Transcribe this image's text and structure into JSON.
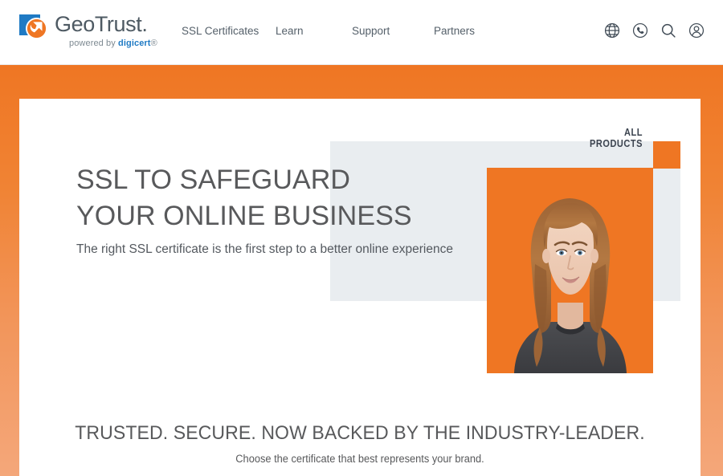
{
  "header": {
    "logo": {
      "name": "GeoTrust",
      "wordmark": "GeoTrust",
      "trademark": ".",
      "tagline_prefix": "powered by ",
      "tagline_brand": "digicert",
      "tagline_suffix": "®"
    },
    "nav": [
      {
        "label": "SSL Certificates",
        "name": "nav-ssl-certificates"
      },
      {
        "label": "Learn",
        "name": "nav-learn"
      },
      {
        "label": "Support",
        "name": "nav-support"
      },
      {
        "label": "Partners",
        "name": "nav-partners"
      }
    ],
    "icons": [
      {
        "name": "globe-icon",
        "title": "Language"
      },
      {
        "name": "phone-icon",
        "title": "Contact"
      },
      {
        "name": "search-icon",
        "title": "Search"
      },
      {
        "name": "user-account-icon",
        "title": "Account"
      }
    ]
  },
  "hero": {
    "all_products_label": "ALL PRODUCTS",
    "heading_line1": "SSL TO SAFEGUARD",
    "heading_line2": "YOUR ONLINE BUSINESS",
    "subtext": "The right SSL certificate is the first step to a better online experience",
    "image_alt": "Smiling woman portrait on orange background"
  },
  "section": {
    "title": "TRUSTED. SECURE. NOW BACKED BY THE INDUSTRY-LEADER.",
    "subtitle": "Choose the certificate that best represents your brand."
  },
  "colors": {
    "brand_orange": "#ef7623",
    "logo_blue": "#1f7ac4",
    "panel_gray": "#e9edf0",
    "text_gray": "#58595b",
    "nav_gray": "#55606a"
  }
}
